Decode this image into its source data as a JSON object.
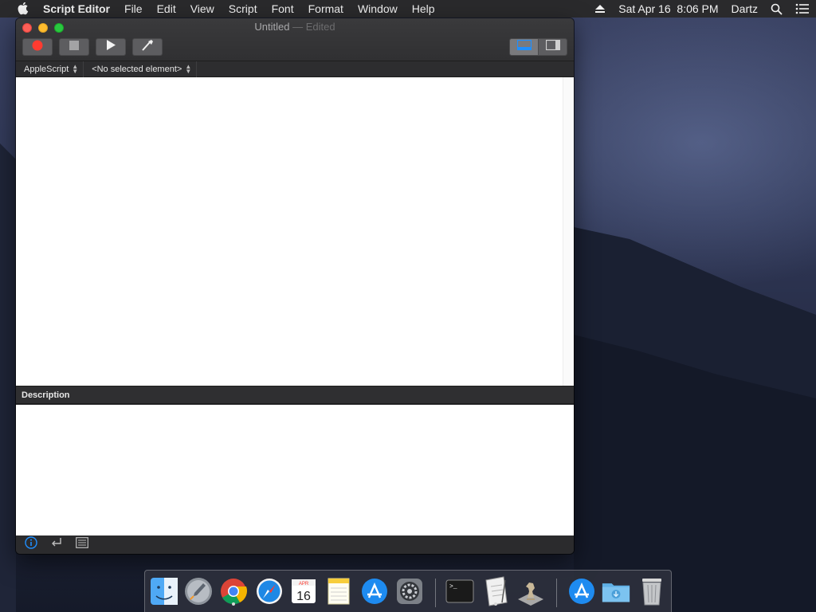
{
  "menubar": {
    "app_name": "Script Editor",
    "menus": [
      "File",
      "Edit",
      "View",
      "Script",
      "Font",
      "Format",
      "Window",
      "Help"
    ],
    "datetime": "Sat Apr 16  8:06 PM",
    "user": "Dartz"
  },
  "window": {
    "title": "Untitled",
    "title_suffix": " — Edited",
    "toolbar": {
      "record_icon": "record-icon",
      "stop_icon": "stop-icon",
      "run_icon": "play-icon",
      "compile_icon": "hammer-icon"
    },
    "navigator": {
      "language": "AppleScript",
      "element": "<No selected element>"
    },
    "description_header": "Description"
  },
  "dock": {
    "calendar_month": "APR",
    "calendar_day": "16",
    "terminal_prompt": ">_"
  }
}
